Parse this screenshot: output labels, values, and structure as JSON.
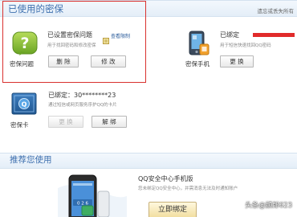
{
  "top_section": {
    "title": "已使用的密保",
    "hint": "遗忘或丢失所有"
  },
  "items": {
    "security_question": {
      "icon": "question-mark-icon",
      "caption": "密保问题",
      "status": "已设置密保问题",
      "link": "查看限制",
      "desc": "用于找回密码和修改密保",
      "delete_label": "删 除",
      "modify_label": "修 改"
    },
    "security_phone": {
      "icon": "mobile-phone-icon",
      "caption": "密保手机",
      "status": "已绑定",
      "desc": "用于短信快速找回QQ密码",
      "change_label": "更 换"
    },
    "security_card": {
      "icon": "security-card-icon",
      "caption": "密保卡",
      "status": "已绑定：30********23",
      "desc": "通过短信或网页服务序护QQ的卡片",
      "change_label": "更 换",
      "unbind_label": "解 绑"
    }
  },
  "recommend": {
    "title": "推荐您使用",
    "promo_title": "QQ安全中心手机版",
    "promo_desc": "您未绑定QQ安全中心，并需消息无法及时通知账户",
    "bind_label": "立即绑定",
    "phone_icon": "smartphone-image"
  },
  "watermark": "头条@颜郎623",
  "colors": {
    "highlight": "#d9312f",
    "section_title": "#3d6fae",
    "masked_number": "#e12a2a"
  }
}
